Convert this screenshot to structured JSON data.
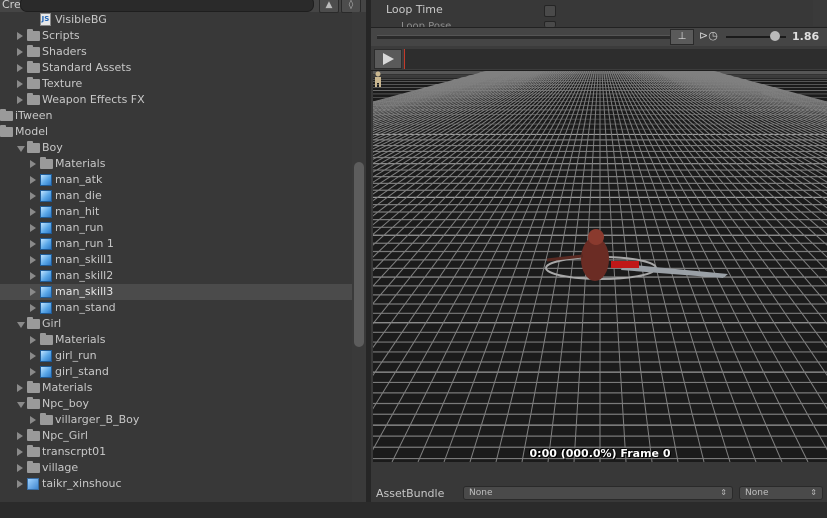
{
  "project": {
    "create_label": "Create",
    "create_arrow": "▾",
    "search_placeholder": "",
    "tree": [
      {
        "label": "VisibleBG",
        "icon": "script",
        "indent": 2,
        "expand": "none"
      },
      {
        "label": "Scripts",
        "icon": "folder",
        "indent": 1,
        "expand": "closed"
      },
      {
        "label": "Shaders",
        "icon": "folder",
        "indent": 1,
        "expand": "closed"
      },
      {
        "label": "Standard Assets",
        "icon": "folder",
        "indent": 1,
        "expand": "closed"
      },
      {
        "label": "Texture",
        "icon": "folder",
        "indent": 1,
        "expand": "closed"
      },
      {
        "label": "Weapon Effects FX",
        "icon": "folder",
        "indent": 1,
        "expand": "closed"
      },
      {
        "label": "iTween",
        "icon": "folder",
        "indent": 0,
        "expand": "none"
      },
      {
        "label": "Model",
        "icon": "folder",
        "indent": 0,
        "expand": "none"
      },
      {
        "label": "Boy",
        "icon": "folder",
        "indent": 1,
        "expand": "open"
      },
      {
        "label": "Materials",
        "icon": "folder",
        "indent": 2,
        "expand": "closed"
      },
      {
        "label": "man_atk",
        "icon": "model",
        "indent": 2,
        "expand": "closed"
      },
      {
        "label": "man_die",
        "icon": "model",
        "indent": 2,
        "expand": "closed"
      },
      {
        "label": "man_hit",
        "icon": "model",
        "indent": 2,
        "expand": "closed"
      },
      {
        "label": "man_run",
        "icon": "model",
        "indent": 2,
        "expand": "closed"
      },
      {
        "label": "man_run 1",
        "icon": "model",
        "indent": 2,
        "expand": "closed"
      },
      {
        "label": "man_skill1",
        "icon": "model",
        "indent": 2,
        "expand": "closed"
      },
      {
        "label": "man_skill2",
        "icon": "model",
        "indent": 2,
        "expand": "closed"
      },
      {
        "label": "man_skill3",
        "icon": "model",
        "indent": 2,
        "expand": "closed",
        "selected": true
      },
      {
        "label": "man_stand",
        "icon": "model",
        "indent": 2,
        "expand": "closed"
      },
      {
        "label": "Girl",
        "icon": "folder",
        "indent": 1,
        "expand": "open"
      },
      {
        "label": "Materials",
        "icon": "folder",
        "indent": 2,
        "expand": "closed"
      },
      {
        "label": "girl_run",
        "icon": "model",
        "indent": 2,
        "expand": "closed"
      },
      {
        "label": "girl_stand",
        "icon": "model",
        "indent": 2,
        "expand": "closed"
      },
      {
        "label": "Materials",
        "icon": "folder",
        "indent": 1,
        "expand": "closed"
      },
      {
        "label": "Npc_boy",
        "icon": "folder",
        "indent": 1,
        "expand": "open"
      },
      {
        "label": "villarger_B_Boy",
        "icon": "folder",
        "indent": 2,
        "expand": "closed"
      },
      {
        "label": "Npc_Girl",
        "icon": "folder",
        "indent": 1,
        "expand": "closed"
      },
      {
        "label": "transcrpt01",
        "icon": "folder",
        "indent": 1,
        "expand": "closed"
      },
      {
        "label": "village",
        "icon": "folder",
        "indent": 1,
        "expand": "closed"
      },
      {
        "label": "taikr_xinshouc",
        "icon": "model-prefab",
        "indent": 1,
        "expand": "closed"
      }
    ]
  },
  "inspector": {
    "loop_time_label": "Loop Time",
    "loop_pose_label": "Loop Pose",
    "speed_value": "1.86",
    "speed_level": 0.82,
    "frame_label": "0:00 (000.0%) Frame 0",
    "assetbundle_label": "AssetBundle",
    "bundle_name": "None",
    "bundle_variant": "None",
    "caret": "⇕",
    "speed_icon": "⊳◷",
    "pivot_icon": "⊥"
  },
  "icons": {
    "accent": "#2f7ad1",
    "timeline_cursor": "#c43a2a"
  }
}
